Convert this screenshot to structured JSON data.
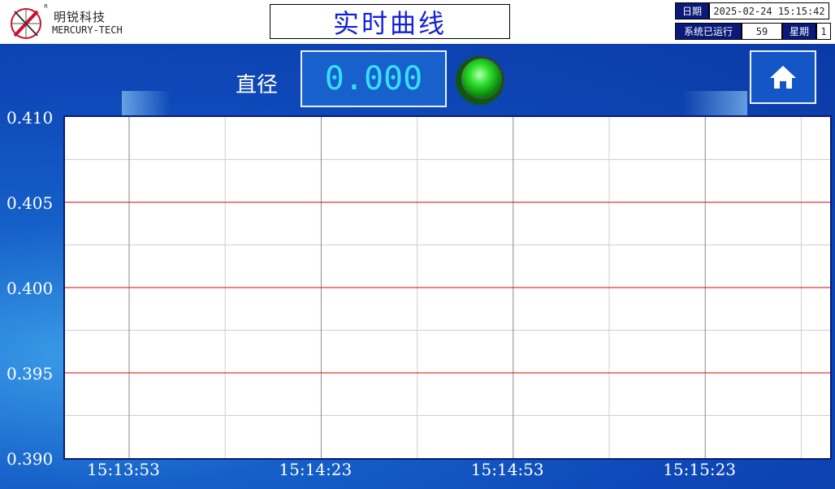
{
  "header": {
    "brand_cn": "明锐科技",
    "brand_en": "MERCURY-TECH",
    "registered_mark": "R",
    "page_title": "实时曲线",
    "date_label": "日期",
    "date_value": "2025-02-24 15:15:42",
    "runtime_label": "系统已运行",
    "runtime_value": "59",
    "weekday_label": "星期",
    "weekday_value": "1"
  },
  "measure": {
    "label": "直径",
    "value": "0.000",
    "status_lamp": "green-lamp-icon",
    "status_color": "#22cc22"
  },
  "nav": {
    "home_icon": "home-icon"
  },
  "chart_data": {
    "type": "line",
    "y_ticks": [
      "0.410",
      "0.405",
      "0.400",
      "0.395",
      "0.390"
    ],
    "x_ticks": [
      "15:13:53",
      "15:14:23",
      "15:14:53",
      "15:15:23"
    ],
    "ylim": [
      0.39,
      0.41
    ],
    "limit_lines": [
      0.405,
      0.4,
      0.395
    ],
    "limit_line_color": "#dd0000",
    "series": []
  },
  "colors": {
    "panel_bg": "#0e48b8",
    "title_text": "#1222d8",
    "value_text": "#35e0ff"
  }
}
